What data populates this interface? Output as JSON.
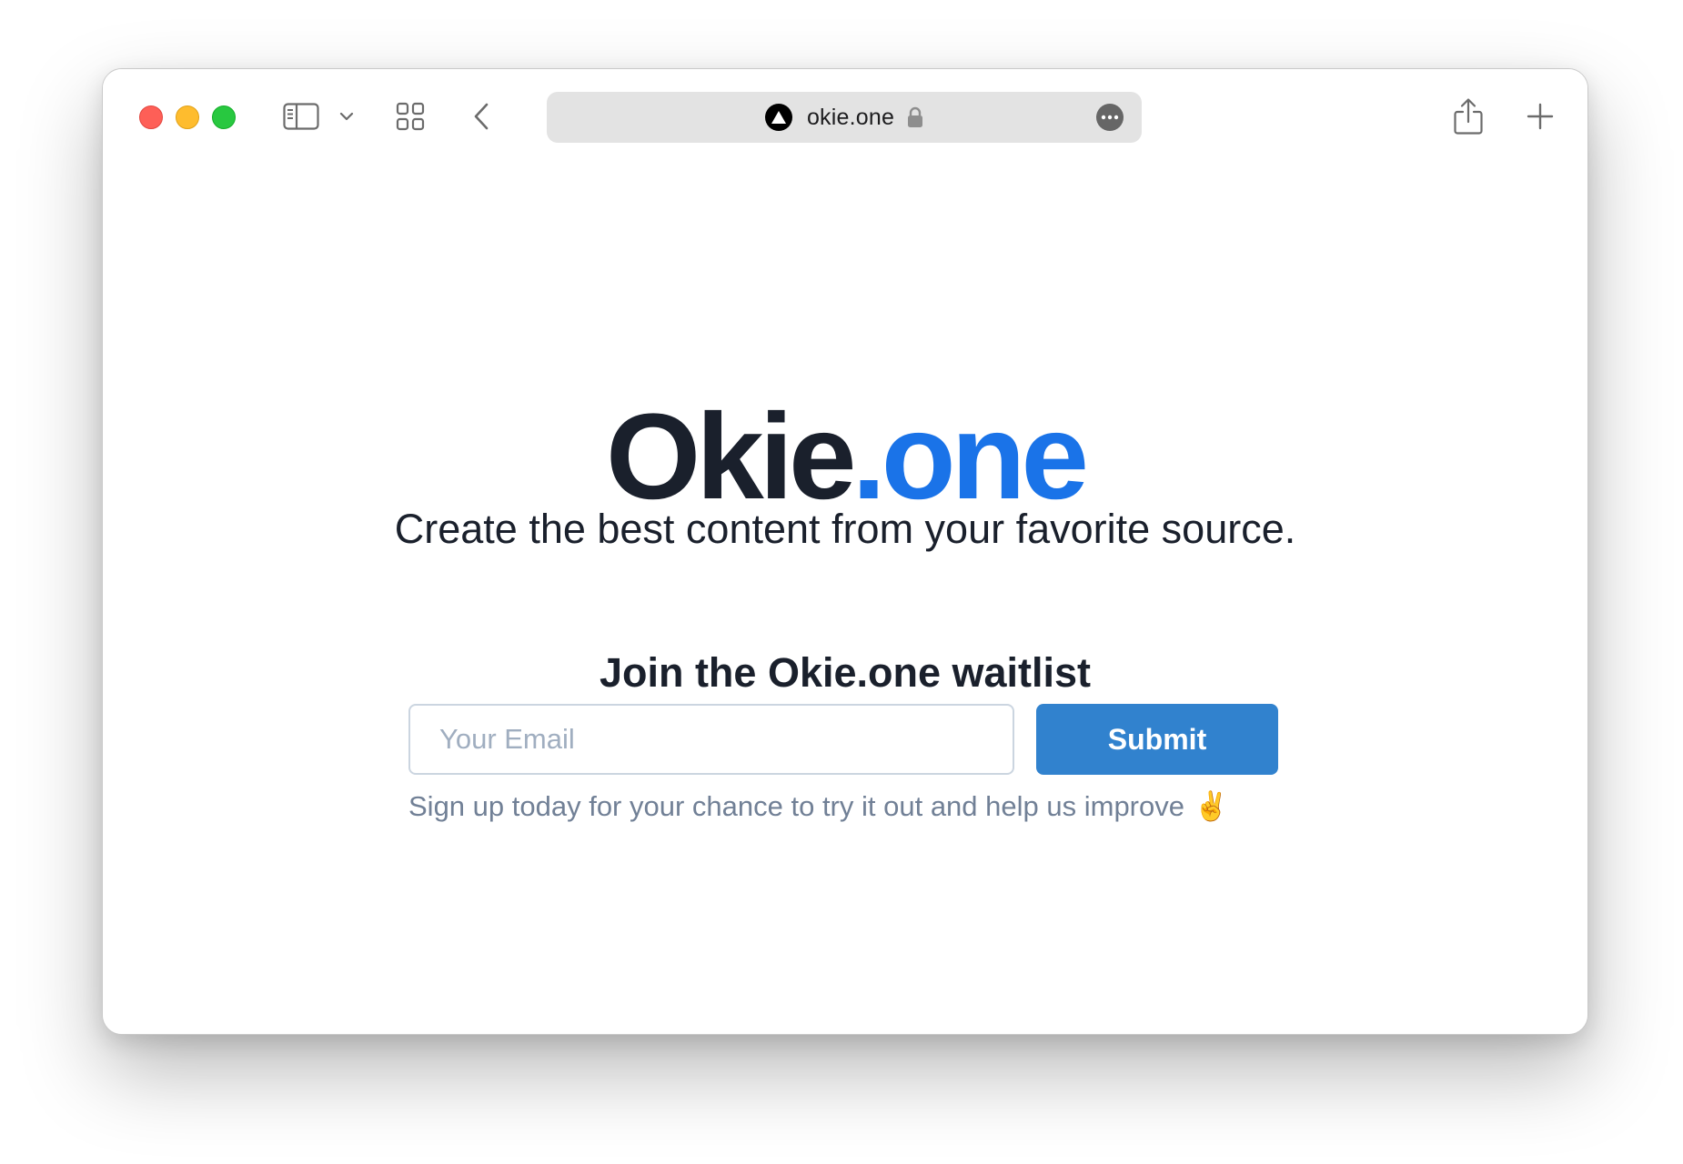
{
  "browser": {
    "url": "okie.one",
    "icons": {
      "sidebar": "sidebar-icon",
      "chevron": "chevron-down-icon",
      "tabs": "tab-overview-icon",
      "back": "back-arrow-icon",
      "site": "triangle-site-icon",
      "lock": "lock-icon",
      "more": "more-icon",
      "share": "share-icon",
      "new_tab": "plus-icon"
    }
  },
  "page": {
    "logo": {
      "part1": "Okie",
      "part2": ".one"
    },
    "tagline": "Create the best content from your favorite source.",
    "waitlist_heading": "Join the Okie.one waitlist",
    "email": {
      "placeholder": "Your Email",
      "value": ""
    },
    "submit_label": "Submit",
    "signup_note": "Sign up today for your chance to try it out and help us improve",
    "signup_emoji": "✌️"
  },
  "colors": {
    "brand_dark": "#1a202c",
    "brand_blue": "#1a73e8",
    "button": "#3182ce",
    "muted_text": "#718096"
  }
}
